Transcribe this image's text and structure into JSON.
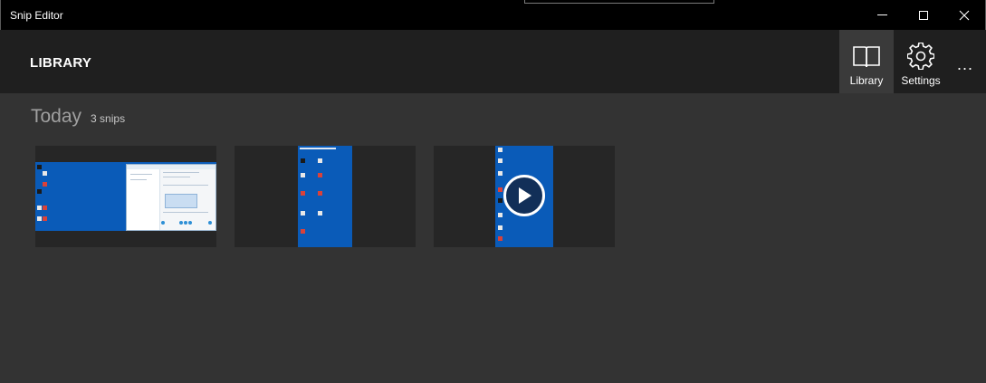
{
  "window": {
    "title": "Snip Editor",
    "controls": [
      "minimize",
      "maximize",
      "close"
    ]
  },
  "header": {
    "page_title": "LIBRARY",
    "nav": [
      {
        "label": "Library",
        "icon": "book-icon",
        "active": true
      },
      {
        "label": "Settings",
        "icon": "gear-icon",
        "active": false
      }
    ],
    "more_label": "..."
  },
  "library": {
    "section_title": "Today",
    "section_count": "3 snips",
    "snips": [
      {
        "type": "image",
        "preview": "desktop with chat window"
      },
      {
        "type": "image",
        "preview": "desktop icons"
      },
      {
        "type": "video",
        "preview": "desktop icons",
        "overlay_icon": "play-icon"
      }
    ]
  },
  "colors": {
    "titlebar": "#000000",
    "header": "#1f1f1f",
    "content": "#333333",
    "active_nav": "#3a3a3a",
    "desktop_blue": "#0a5bb8"
  }
}
